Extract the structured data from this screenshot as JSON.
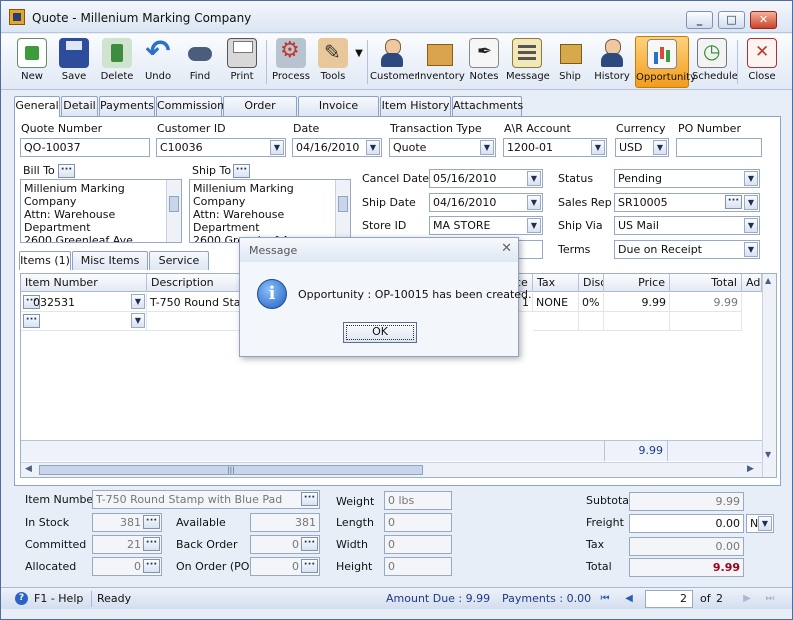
{
  "window": {
    "title": "Quote - Millenium Marking Company"
  },
  "toolbar": {
    "new": "New",
    "save": "Save",
    "delete": "Delete",
    "undo": "Undo",
    "find": "Find",
    "print": "Print",
    "process": "Process",
    "tools": "Tools",
    "customer": "Customer",
    "inventory": "Inventory",
    "notes": "Notes",
    "message": "Message",
    "ship": "Ship",
    "history": "History",
    "opportunity": "Opportunity",
    "schedule": "Schedule",
    "close": "Close"
  },
  "tabs": [
    "General",
    "Detail",
    "Payments",
    "Commission",
    "Order History",
    "Invoice History",
    "Item History",
    "Attachments"
  ],
  "header": {
    "quote_number_label": "Quote Number",
    "quote_number": "QO-10037",
    "customer_id_label": "Customer ID",
    "customer_id": "C10036",
    "date_label": "Date",
    "date": "04/16/2010",
    "transaction_type_label": "Transaction Type",
    "transaction_type": "Quote",
    "ar_account_label": "A\\R Account",
    "ar_account": "1200-01",
    "currency_label": "Currency",
    "currency": "USD",
    "po_number_label": "PO Number",
    "po_number": ""
  },
  "bill_to": {
    "label": "Bill To",
    "lines": [
      "Millenium Marking Company",
      "Attn: Warehouse",
      "Department",
      "2600 Greenleaf Ave"
    ]
  },
  "ship_to": {
    "label": "Ship To",
    "lines": [
      "Millenium Marking Company",
      "Attn: Warehouse",
      "Department",
      "2600 Greenleaf Ave"
    ]
  },
  "dates": {
    "cancel_date_label": "Cancel Date",
    "cancel_date": "05/16/2010",
    "ship_date_label": "Ship Date",
    "ship_date": "04/16/2010",
    "store_id_label": "Store ID",
    "store_id": "MA STORE"
  },
  "right": {
    "status_label": "Status",
    "status": "Pending",
    "sales_rep_label": "Sales Rep",
    "sales_rep": "SR10005",
    "ship_via_label": "Ship Via",
    "ship_via": "US Mail",
    "terms_label": "Terms",
    "terms": "Due on Receipt"
  },
  "subtabs": [
    "Items (1)",
    "Misc Items (0)",
    "Service (0)"
  ],
  "grid": {
    "columns": [
      "Item Number",
      "Description",
      "ce",
      "Tax",
      "Disc",
      "Price",
      "Total",
      "Ad"
    ],
    "rows": [
      {
        "item": "032531",
        "description": "T-750 Round Stam",
        "qty": "1",
        "tax": "NONE",
        "disc": "0%",
        "price": "9.99",
        "total": "9.99"
      }
    ],
    "grand_total": "9.99"
  },
  "item_info": {
    "item_number_label": "Item Number",
    "item_number": "T-750 Round Stamp with Blue Pad",
    "in_stock_label": "In Stock",
    "in_stock": "381",
    "committed_label": "Committed",
    "committed": "21",
    "allocated_label": "Allocated",
    "allocated": "0",
    "available_label": "Available",
    "available": "381",
    "back_order_label": "Back Order",
    "back_order": "0",
    "on_order_label": "On Order (PO)",
    "on_order": "0",
    "weight_label": "Weight",
    "weight": "0 lbs",
    "length_label": "Length",
    "length": "0",
    "width_label": "Width",
    "width": "0",
    "height_label": "Height",
    "height": "0"
  },
  "totals": {
    "subtotal_label": "Subtotal",
    "subtotal": "9.99",
    "freight_label": "Freight",
    "freight": "0.00",
    "freight_unit": "N",
    "tax_label": "Tax",
    "tax": "0.00",
    "total_label": "Total",
    "total": "9.99"
  },
  "status_bar": {
    "help": "F1 - Help",
    "state": "Ready",
    "amount_due": "Amount Due : 9.99",
    "payments": "Payments : 0.00",
    "page": "2",
    "of": "of",
    "page_count": "2"
  },
  "dialog": {
    "title": "Message",
    "message": "Opportunity : OP-10015 has been created.",
    "ok": "OK"
  },
  "colors": {
    "accent": "#f29c1c",
    "total_red": "#a0001a"
  }
}
